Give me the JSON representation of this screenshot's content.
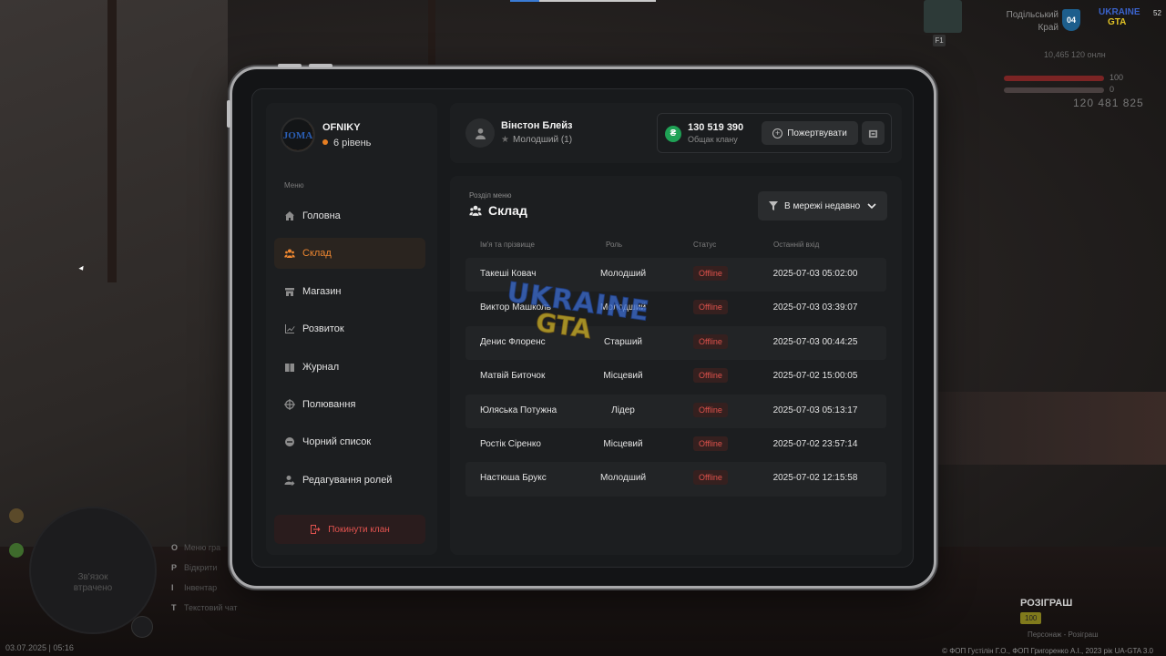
{
  "hud": {
    "region_line1": "Подільський",
    "region_line2": "Край",
    "region_code": "04",
    "logo_top": "UKRAINE",
    "logo_bottom": "GTA",
    "ping": "52",
    "car_number": "F1",
    "stats": "10,465   120 онлн",
    "health_value": "100",
    "armor_value": "0",
    "money": "120 481 825",
    "minimap_line1": "Зв'язок",
    "minimap_line2": "втрачено",
    "datetime": "03.07.2025 | 05:16",
    "hotkeys": [
      {
        "key": "O",
        "label": "Меню гра"
      },
      {
        "key": "P",
        "label": "Відкрити"
      },
      {
        "key": "I",
        "label": "Інвентар"
      },
      {
        "key": "T",
        "label": "Текстовий чат"
      }
    ],
    "giveaway_title": "РОЗІГРАШ",
    "giveaway_tag": "100",
    "giveaway_bottom": "Персонаж - Розіграш",
    "copyright": "© ФОП Густілін Г.О., ФОП Григоренко А.І., 2023 рік UA-GTA 3.0"
  },
  "clan": {
    "avatar_text": "JOMA",
    "name": "OFNIKY",
    "level": "6 рівень"
  },
  "menu": {
    "caption": "Меню",
    "items": [
      {
        "label": "Головна",
        "icon": "home-icon"
      },
      {
        "label": "Склад",
        "icon": "users-icon",
        "active": true
      },
      {
        "label": "Магазин",
        "icon": "shop-icon"
      },
      {
        "label": "Розвиток",
        "icon": "chart-icon"
      },
      {
        "label": "Журнал",
        "icon": "book-icon"
      },
      {
        "label": "Полювання",
        "icon": "crosshair-icon"
      },
      {
        "label": "Чорний список",
        "icon": "ban-icon"
      },
      {
        "label": "Редагування ролей",
        "icon": "user-edit-icon"
      }
    ],
    "leave_label": "Покинути клан"
  },
  "user": {
    "name": "Вінстон Блейз",
    "rank": "Молодший (1)"
  },
  "bank": {
    "amount": "130 519 390",
    "label": "Общак клану",
    "donate_label": "Пожертвувати"
  },
  "section": {
    "caption": "Розділ меню",
    "title": "Склад",
    "filter_label": "В мережі недавно"
  },
  "table": {
    "headers": {
      "name": "Ім'я та прізвище",
      "role": "Роль",
      "status": "Статус",
      "last": "Останній вхід"
    },
    "rows": [
      {
        "name": "Такеші Ковач",
        "role": "Молодший",
        "status": "Offline",
        "last": "2025-07-03 05:02:00"
      },
      {
        "name": "Виктор Машколь",
        "role": "Молодший",
        "status": "Offline",
        "last": "2025-07-03 03:39:07"
      },
      {
        "name": "Денис Флоренс",
        "role": "Старший",
        "status": "Offline",
        "last": "2025-07-03 00:44:25"
      },
      {
        "name": "Матвій Биточок",
        "role": "Місцевий",
        "status": "Offline",
        "last": "2025-07-02 15:00:05"
      },
      {
        "name": "Юляська Потужна",
        "role": "Лідер",
        "status": "Offline",
        "last": "2025-07-03 05:13:17"
      },
      {
        "name": "Ростік Сіренко",
        "role": "Місцевий",
        "status": "Offline",
        "last": "2025-07-02 23:57:14"
      },
      {
        "name": "Настюша Брукс",
        "role": "Молодший",
        "status": "Offline",
        "last": "2025-07-02 12:15:58"
      }
    ]
  },
  "watermark": {
    "line1": "UKRAINE",
    "line2": "GTA"
  },
  "colors": {
    "accent": "#ee8731",
    "offline": "#e0524c",
    "coin": "#1fa155",
    "danger": "#e2534f"
  }
}
